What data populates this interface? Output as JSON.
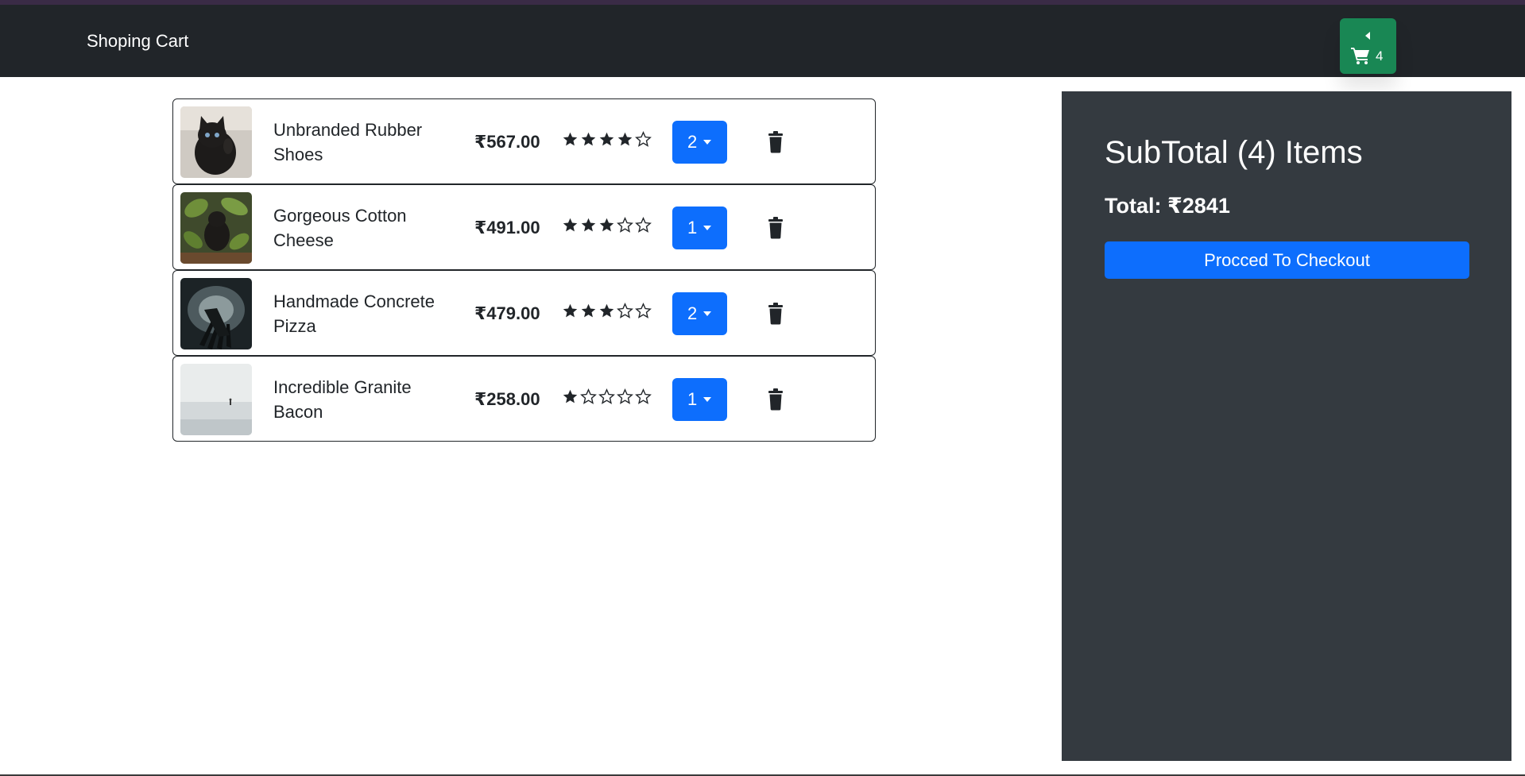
{
  "navbar": {
    "brand": "Shoping Cart",
    "cart_count": "4"
  },
  "cart_items": [
    {
      "name": "Unbranded Rubber Shoes",
      "price": "₹567.00",
      "rating": 4,
      "qty": "2",
      "thumbnail": "black kitten"
    },
    {
      "name": "Gorgeous Cotton Cheese",
      "price": "₹491.00",
      "rating": 3,
      "qty": "1",
      "thumbnail": "cat among plant leaves"
    },
    {
      "name": "Handmade Concrete Pizza",
      "price": "₹479.00",
      "rating": 3,
      "qty": "2",
      "thumbnail": "dark fork close-up"
    },
    {
      "name": "Incredible Granite Bacon",
      "price": "₹258.00",
      "rating": 1,
      "qty": "1",
      "thumbnail": "misty lake figure"
    }
  ],
  "summary": {
    "title": "SubTotal (4) Items",
    "total": "Total: ₹2841",
    "checkout_label": "Procced To Checkout"
  },
  "colors": {
    "navbar": "#212529",
    "cart_button": "#198754",
    "primary": "#0d6efd",
    "summary_panel": "#343a40"
  }
}
